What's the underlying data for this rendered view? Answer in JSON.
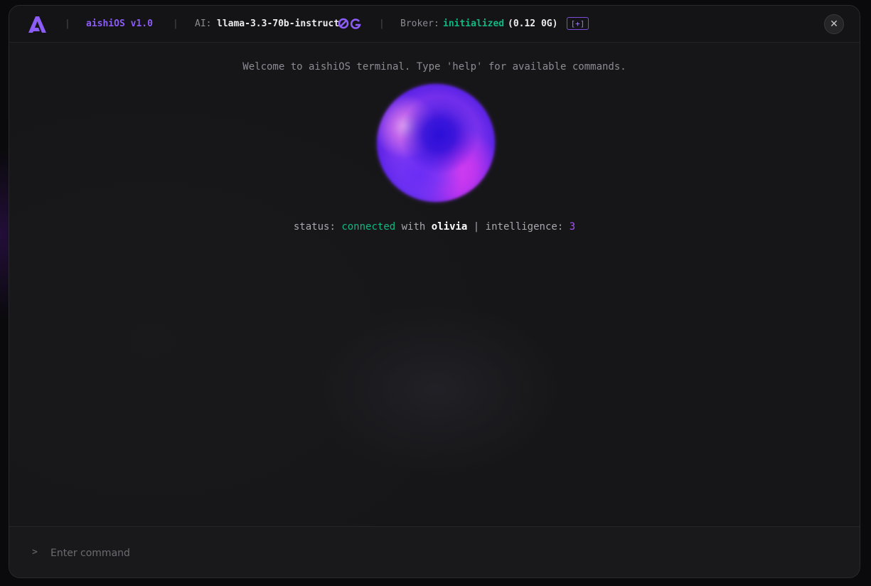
{
  "header": {
    "app_version": "aishiOS v1.0",
    "ai_label": "AI:",
    "model_name": "llama-3.3-70b-instruct",
    "model_icon": "0g-logo-icon",
    "broker_label": "Broker:",
    "broker_status": "initialized",
    "broker_balance": "(0.12 0G)",
    "broker_add_label": "[+]",
    "separator": "|",
    "close_label": "✕"
  },
  "terminal": {
    "welcome": "Welcome to aishiOS terminal. Type 'help' for available commands.",
    "status_label": "status:",
    "status_value": "connected",
    "with_label": "with",
    "agent_name": "olivia",
    "divider": "|",
    "intelligence_label": "intelligence:",
    "intelligence_value": "3"
  },
  "input": {
    "prompt": ">",
    "placeholder": "Enter command"
  },
  "colors": {
    "accent": "#8b5cf6",
    "success": "#10b981",
    "background": "#161618"
  }
}
